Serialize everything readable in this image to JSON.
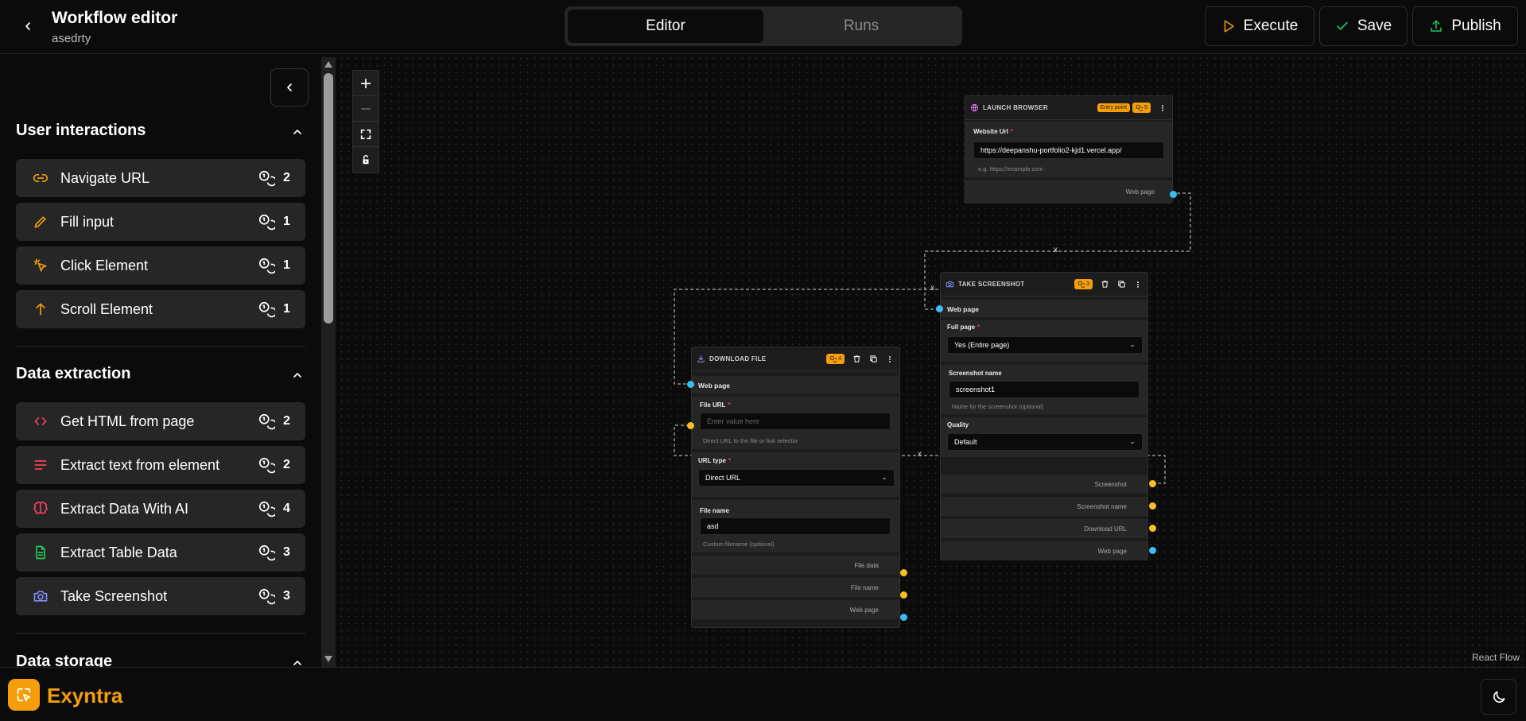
{
  "header": {
    "title": "Workflow editor",
    "subtitle": "asedrty",
    "tabs": [
      {
        "label": "Editor"
      },
      {
        "label": "Runs"
      }
    ],
    "execute_label": "Execute",
    "save_label": "Save",
    "publish_label": "Publish"
  },
  "sidebar": {
    "sections": [
      {
        "title": "User interactions",
        "items": [
          {
            "label": "Navigate URL",
            "credits": "2",
            "icon": "link-icon",
            "color": "#f59e0b"
          },
          {
            "label": "Fill input",
            "credits": "1",
            "icon": "pencil-icon",
            "color": "#f59e0b"
          },
          {
            "label": "Click Element",
            "credits": "1",
            "icon": "pointer-click-icon",
            "color": "#f59e0b"
          },
          {
            "label": "Scroll Element",
            "credits": "1",
            "icon": "arrow-up-icon",
            "color": "#f59e0b"
          }
        ]
      },
      {
        "title": "Data extraction",
        "items": [
          {
            "label": "Get HTML from page",
            "credits": "2",
            "icon": "code-icon",
            "color": "#f43f5e"
          },
          {
            "label": "Extract text from element",
            "credits": "2",
            "icon": "text-lines-icon",
            "color": "#f43f5e"
          },
          {
            "label": "Extract Data With AI",
            "credits": "4",
            "icon": "brain-icon",
            "color": "#f43f5e"
          },
          {
            "label": "Extract Table Data",
            "credits": "3",
            "icon": "file-sheet-icon",
            "color": "#22c55e"
          },
          {
            "label": "Take Screenshot",
            "credits": "3",
            "icon": "camera-icon",
            "color": "#818cf8"
          }
        ]
      },
      {
        "title": "Data storage",
        "items": []
      }
    ]
  },
  "nodes": {
    "launch_browser": {
      "title": "LAUNCH BROWSER",
      "entry_badge": "Entry point",
      "credits": "5",
      "website_url_label": "Website Url",
      "website_url_value": "https://deepanshu-portfolio2-kjd1.vercel.app/",
      "website_url_help": "e.g. https://example.com",
      "output_web_page": "Web page"
    },
    "take_screenshot": {
      "title": "TAKE SCREENSHOT",
      "credits": "3",
      "input_web_page": "Web page",
      "full_page_label": "Full page",
      "full_page_value": "Yes (Entire page)",
      "screenshot_name_label": "Screenshot name",
      "screenshot_name_value": "screenshot1",
      "screenshot_name_help": "Name for the screenshot (optional)",
      "quality_label": "Quality",
      "quality_value": "Default",
      "outputs": [
        "Screenshot",
        "Screenshot name",
        "Download URL",
        "Web page"
      ]
    },
    "download_file": {
      "title": "DOWNLOAD FILE",
      "credits": "4",
      "input_web_page": "Web page",
      "file_url_label": "File URL",
      "file_url_placeholder": "Enter value here",
      "file_url_help": "Direct URL to the file or link selector",
      "url_type_label": "URL type",
      "url_type_value": "Direct URL",
      "file_name_label": "File name",
      "file_name_value": "asd",
      "file_name_help": "Custom filename (optional)",
      "outputs": [
        "File data",
        "File name",
        "Web page"
      ]
    }
  },
  "edge_delete_glyph": "x",
  "attribution": "React Flow",
  "footer": {
    "brand": "Exyntra"
  },
  "colors": {
    "accent": "#f59e0b",
    "handle_blue": "#38bdf8",
    "handle_yellow": "#fbbf24"
  }
}
